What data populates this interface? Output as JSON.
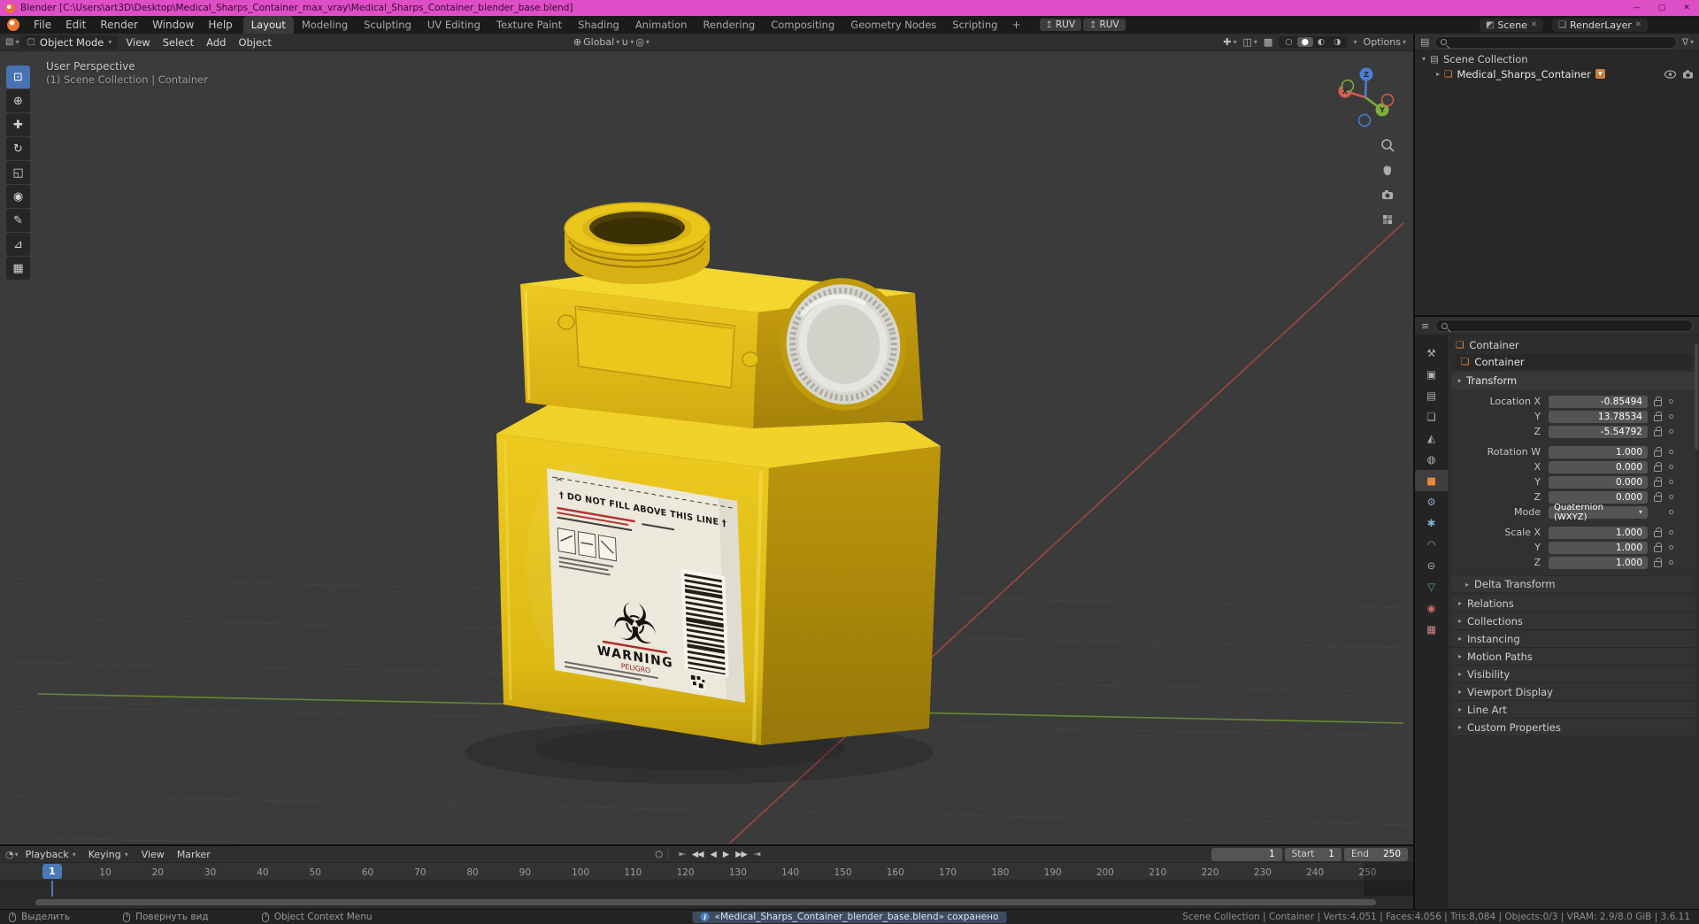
{
  "window": {
    "title": "Blender [C:\\Users\\art3D\\Desktop\\Medical_Sharps_Container_max_vray\\Medical_Sharps_Container_blender_base.blend]"
  },
  "icons": {
    "dropdown": "▾",
    "disclosure": "▸",
    "expanded": "▾",
    "close": "✕",
    "minimize": "—",
    "maximize": "▢",
    "plus": "+",
    "viewport_editor": "▧",
    "outliner_editor": "▤",
    "properties_editor": "≡",
    "timeline_editor": "◔",
    "mode_cube": "▢",
    "globe": "⊕",
    "magnet": "∪",
    "proportional": "◎",
    "gizmo_toggle": "✚",
    "overlays": "◫",
    "xray": "▩",
    "scene": "◩",
    "render_layer": "❏",
    "ruv_up": "↥",
    "ruv_down": "↧",
    "collection": "▤",
    "object_cube": "❑",
    "autokey": "○",
    "funnel": "∇",
    "badge_triangle": "▼"
  },
  "topbar": {
    "menus": [
      "File",
      "Edit",
      "Render",
      "Window",
      "Help"
    ],
    "workspaces": [
      {
        "label": "Layout",
        "active": true
      },
      {
        "label": "Modeling"
      },
      {
        "label": "Sculpting"
      },
      {
        "label": "UV Editing"
      },
      {
        "label": "Texture Paint"
      },
      {
        "label": "Shading"
      },
      {
        "label": "Animation"
      },
      {
        "label": "Rendering"
      },
      {
        "label": "Compositing"
      },
      {
        "label": "Geometry Nodes"
      },
      {
        "label": "Scripting"
      }
    ],
    "ruv_buttons": [
      {
        "name": "ruv-export-button",
        "label": "RUV"
      },
      {
        "name": "ruv-import-button",
        "label": "RUV"
      }
    ],
    "scene": "Scene",
    "view_layer": "RenderLayer"
  },
  "view_header": {
    "mode": "Object Mode",
    "menus": [
      "View",
      "Select",
      "Add",
      "Object"
    ],
    "orientation": "Global",
    "shading_modes": [
      {
        "name": "shading-wireframe-button",
        "glyph": "○"
      },
      {
        "name": "shading-solid-button",
        "glyph": "●",
        "active": true
      },
      {
        "name": "shading-material-button",
        "glyph": "◐"
      },
      {
        "name": "shading-rendered-button",
        "glyph": "◑"
      }
    ],
    "options_label": "Options"
  },
  "tools": [
    {
      "name": "select-box-tool-button",
      "glyph": "⊡",
      "active": true
    },
    {
      "name": "cursor-tool-button",
      "glyph": "⊕"
    },
    {
      "name": "move-tool-button",
      "glyph": "✚"
    },
    {
      "name": "rotate-tool-button",
      "glyph": "↻"
    },
    {
      "name": "scale-tool-button",
      "glyph": "◱"
    },
    {
      "name": "transform-tool-button",
      "glyph": "◉"
    },
    {
      "name": "annotate-tool-button",
      "glyph": "✎"
    },
    {
      "name": "measure-tool-button",
      "glyph": "⊿"
    },
    {
      "name": "add-cube-tool-button",
      "glyph": "▦"
    }
  ],
  "viewport": {
    "perspective_label": "User Perspective",
    "context_label": "(1) Scene Collection | Container",
    "gizmo": {
      "x": "X",
      "y": "Y",
      "z": "Z"
    },
    "label_texts": {
      "do_not_fill": "† DO NOT FILL ABOVE THIS LINE †",
      "warning": "WARNING",
      "peligro": "PELIGRO",
      "biohazard_glyph": "☣"
    }
  },
  "outliner": {
    "scene_collection": "Scene Collection",
    "object_name": "Medical_Sharps_Container"
  },
  "properties": {
    "tabs": [
      {
        "name": "tab-tool",
        "glyph": "⚒",
        "color": "#b3b3b3"
      },
      {
        "name": "tab-render",
        "glyph": "▣",
        "color": "#b3b3b3"
      },
      {
        "name": "tab-output",
        "glyph": "▤",
        "color": "#b3b3b3"
      },
      {
        "name": "tab-view-layer",
        "glyph": "❏",
        "color": "#b3b3b3"
      },
      {
        "name": "tab-scene",
        "glyph": "◭",
        "color": "#b3b3b3"
      },
      {
        "name": "tab-world",
        "glyph": "◍",
        "color": "#b3b3b3"
      },
      {
        "name": "tab-object",
        "glyph": "■",
        "color": "#e98b3a",
        "active": true
      },
      {
        "name": "tab-modifiers",
        "glyph": "⚙",
        "color": "#8fa8c8"
      },
      {
        "name": "tab-particles",
        "glyph": "✱",
        "color": "#7fb3d0"
      },
      {
        "name": "tab-physics",
        "glyph": "◠",
        "color": "#7fb3d0"
      },
      {
        "name": "tab-constraints",
        "glyph": "⊝",
        "color": "#b3b3b3"
      },
      {
        "name": "tab-data",
        "glyph": "▽",
        "color": "#4fae8d"
      },
      {
        "name": "tab-material",
        "glyph": "◉",
        "color": "#d66a6a"
      },
      {
        "name": "tab-texture",
        "glyph": "▦",
        "color": "#d68a8a"
      }
    ],
    "breadcrumb_object": "Container",
    "object_name": "Container",
    "transform": {
      "title": "Transform",
      "loc_rows": [
        {
          "label": "Location X",
          "value": "-0.85494"
        },
        {
          "label": "Y",
          "value": "13.78534"
        },
        {
          "label": "Z",
          "value": "-5.54792"
        }
      ],
      "rot_rows": [
        {
          "label": "Rotation W",
          "value": "1.000"
        },
        {
          "label": "X",
          "value": "0.000"
        },
        {
          "label": "Y",
          "value": "0.000"
        },
        {
          "label": "Z",
          "value": "0.000"
        }
      ],
      "mode_label": "Mode",
      "mode_value": "Quaternion (WXYZ)",
      "scale_rows": [
        {
          "label": "Scale X",
          "value": "1.000"
        },
        {
          "label": "Y",
          "value": "1.000"
        },
        {
          "label": "Z",
          "value": "1.000"
        }
      ],
      "subpanel": "Delta Transform"
    },
    "collapsed_panels": [
      "Relations",
      "Collections",
      "Instancing",
      "Motion Paths",
      "Visibility",
      "Viewport Display",
      "Line Art",
      "Custom Properties"
    ]
  },
  "timeline": {
    "menus_dd": [
      "Playback",
      "Keying"
    ],
    "menus_plain": [
      "View",
      "Marker"
    ],
    "transport": [
      {
        "name": "jump-to-start-button",
        "glyph": "⇤"
      },
      {
        "name": "previous-keyframe-button",
        "glyph": "◀◀"
      },
      {
        "name": "play-reverse-button",
        "glyph": "◀"
      },
      {
        "name": "play-button",
        "glyph": "▶"
      },
      {
        "name": "next-keyframe-button",
        "glyph": "▶▶"
      },
      {
        "name": "jump-to-end-button",
        "glyph": "⇥"
      }
    ],
    "current_frame": "1",
    "start_label": "Start",
    "start_value": "1",
    "end_label": "End",
    "end_value": "250",
    "playhead_frame": "1",
    "ruler_labels": [
      "1",
      "10",
      "20",
      "30",
      "40",
      "50",
      "60",
      "70",
      "80",
      "90",
      "100",
      "110",
      "120",
      "130",
      "140",
      "150",
      "160",
      "170",
      "180",
      "190",
      "200",
      "210",
      "220",
      "230",
      "240",
      "250"
    ]
  },
  "statusbar": {
    "hints": [
      {
        "label": "Выделить"
      },
      {
        "label": "Повернуть вид"
      },
      {
        "label": "Object Context Menu"
      }
    ],
    "notification": "«Medical_Sharps_Container_blender_base.blend» сохранено",
    "stats": "Scene Collection | Container | Verts:4,051 | Faces:4,056 | Tris:8,084 | Objects:0/3 | VRAM: 2.9/8.0 GiB | 3.6.11"
  },
  "colors": {
    "accent_blue": "#4772b3",
    "titlebar_pink": "#de4ec6",
    "container_yellow": "#e8c51d"
  }
}
